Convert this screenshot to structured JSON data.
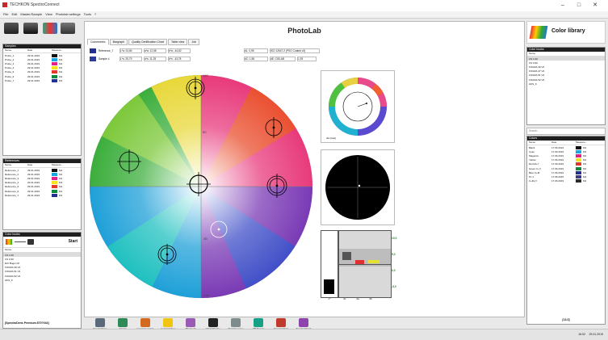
{
  "window": {
    "title": "TECHKON SpectroConnect",
    "controls": [
      "–",
      "□",
      "✕"
    ]
  },
  "menu": [
    "File",
    "Edit",
    "Master/Sample",
    "View",
    "Photolab settings",
    "Tools",
    "?"
  ],
  "samples": {
    "title": "Samples",
    "headers": [
      "Name",
      "Date",
      "Measure..."
    ],
    "rows": [
      {
        "name": "Probe_1",
        "date": "29.01.2019",
        "color": "#101010",
        "meas": "M1"
      },
      {
        "name": "Probe_2",
        "date": "29.01.2019",
        "color": "#1aa7e0",
        "meas": "M1"
      },
      {
        "name": "Probe_3",
        "date": "29.01.2019",
        "color": "#e2208a",
        "meas": "M1"
      },
      {
        "name": "Probe_4",
        "date": "29.01.2019",
        "color": "#f5e31c",
        "meas": "M1"
      },
      {
        "name": "Probe_5",
        "date": "29.01.2019",
        "color": "#e53a2a",
        "meas": "M1"
      },
      {
        "name": "Probe_6",
        "date": "29.01.2019",
        "color": "#0f8a3c",
        "meas": "M1"
      },
      {
        "name": "Probe_7",
        "date": "29.01.2019",
        "color": "#24308e",
        "meas": "M1"
      }
    ]
  },
  "references": {
    "title": "References",
    "headers": [
      "Name",
      "Date",
      "Measure..."
    ],
    "rows": [
      {
        "name": "Reference_1",
        "date": "29.01.2019",
        "color": "#101010",
        "meas": "M1"
      },
      {
        "name": "Reference_2",
        "date": "29.01.2019",
        "color": "#1aa7e0",
        "meas": "M1"
      },
      {
        "name": "Reference_3",
        "date": "29.01.2019",
        "color": "#e2208a",
        "meas": "M1"
      },
      {
        "name": "Reference_4",
        "date": "29.01.2019",
        "color": "#f5e31c",
        "meas": "M1"
      },
      {
        "name": "Reference_5",
        "date": "29.01.2019",
        "color": "#e53a2a",
        "meas": "M1"
      },
      {
        "name": "Reference_6",
        "date": "29.01.2019",
        "color": "#0f8a3c",
        "meas": "M1"
      },
      {
        "name": "Reference_7",
        "date": "29.01.2019",
        "color": "#24308e",
        "meas": "M1"
      }
    ]
  },
  "color_books": {
    "title": "Color books",
    "start_label": "Start",
    "header": "Name",
    "items": [
      "CS 1.00",
      "CS 0.90",
      "ECI Bogen M",
      "FOGRA 39 V2",
      "FOGRA 51 V3",
      "FOGRA 52 V3",
      "HKS_K"
    ],
    "footer": "[SpectroDens Premium 870?044]"
  },
  "photolab": {
    "title": "PhotoLab",
    "tabs": [
      "Colorimetric",
      "Bargraph",
      "Quality Certification Chart",
      "Table view",
      "Job"
    ],
    "ref_label": "Reference_7",
    "sample_label": "Sample 4",
    "ref_values": [
      "L*a: 24,84",
      "a*a: 12,58",
      "b*a: -44,82"
    ],
    "sample_values": [
      "L*s: 25,79",
      "a*s: 11,25",
      "b*s: -43,78"
    ],
    "delta_values": [
      "dL: 0,95",
      "dC: 1,58",
      "dH: 0,25"
    ],
    "standard": "ISO 12647-2 (PSO Coated v3)",
    "de_label": "dE: CIELAB",
    "de_value": "1,93",
    "hue_caption": "dH (Hue)",
    "bar_ticks": [
      "10,0",
      "5,0",
      "0,0",
      "-5,0",
      "-10,0"
    ],
    "bar_labels": [
      "L*",
      "dL",
      "da",
      "db"
    ],
    "wheel_ticks": [
      "100",
      "50",
      "-50",
      "-100"
    ]
  },
  "toolbar": [
    {
      "label": "SpectroDens settings",
      "color": "#5a6a7a"
    },
    {
      "label": "Export",
      "color": "#2e8b57"
    },
    {
      "label": "Compare colors",
      "color": "#d2691e"
    },
    {
      "label": "ColorCatcher",
      "color": "#f1c40f"
    },
    {
      "label": "PhotoLab",
      "color": "#9b59b6"
    },
    {
      "label": "MediaWedge",
      "color": "#222222"
    },
    {
      "label": "Transfer curve",
      "color": "#7f8c8d"
    },
    {
      "label": "DB Report",
      "color": "#16a085"
    },
    {
      "label": "SpectroChart",
      "color": "#c0392b"
    },
    {
      "label": "SpectroCheck",
      "color": "#8e44ad"
    }
  ],
  "library": {
    "title": "Color library",
    "books_title": "Color books",
    "books_header": "Name",
    "books": [
      "CS 1.00",
      "CS 0.90",
      "FOGRA 39 V2",
      "FOGRA 47 V2",
      "FOGRA 51 V3",
      "FOGRA 52 V3",
      "HKS_K"
    ],
    "search_placeholder": "Search...",
    "colors_title": "Colors",
    "colors_headers": [
      "Name",
      "Date",
      "Measure..."
    ],
    "colors": [
      {
        "name": "Black",
        "date": "17.06.2019",
        "color": "#101010",
        "meas": "M1"
      },
      {
        "name": "Cyan",
        "date": "17.06.2019",
        "color": "#1aa7e0",
        "meas": "M1"
      },
      {
        "name": "Magenta",
        "date": "17.06.2019",
        "color": "#e2208a",
        "meas": "M1"
      },
      {
        "name": "Yellow",
        "date": "17.06.2019",
        "color": "#f5e31c",
        "meas": "M1"
      },
      {
        "name": "Red M+Y",
        "date": "17.06.2019",
        "color": "#e53a2a",
        "meas": "M1"
      },
      {
        "name": "Green C+Y",
        "date": "17.06.2019",
        "color": "#0f8a3c",
        "meas": "M1"
      },
      {
        "name": "Blue C+M",
        "date": "17.06.2019",
        "color": "#24308e",
        "meas": "M1"
      },
      {
        "name": "Pc 1",
        "date": "17.06.2019",
        "color": "#3b3b8a",
        "meas": "M1"
      },
      {
        "name": "C+M+Y",
        "date": "17.06.2019",
        "color": "#2a2a2a",
        "meas": "M1"
      }
    ],
    "footer": "[13.0]"
  },
  "status": {
    "time": "16:02",
    "date": "29.01.2019"
  }
}
